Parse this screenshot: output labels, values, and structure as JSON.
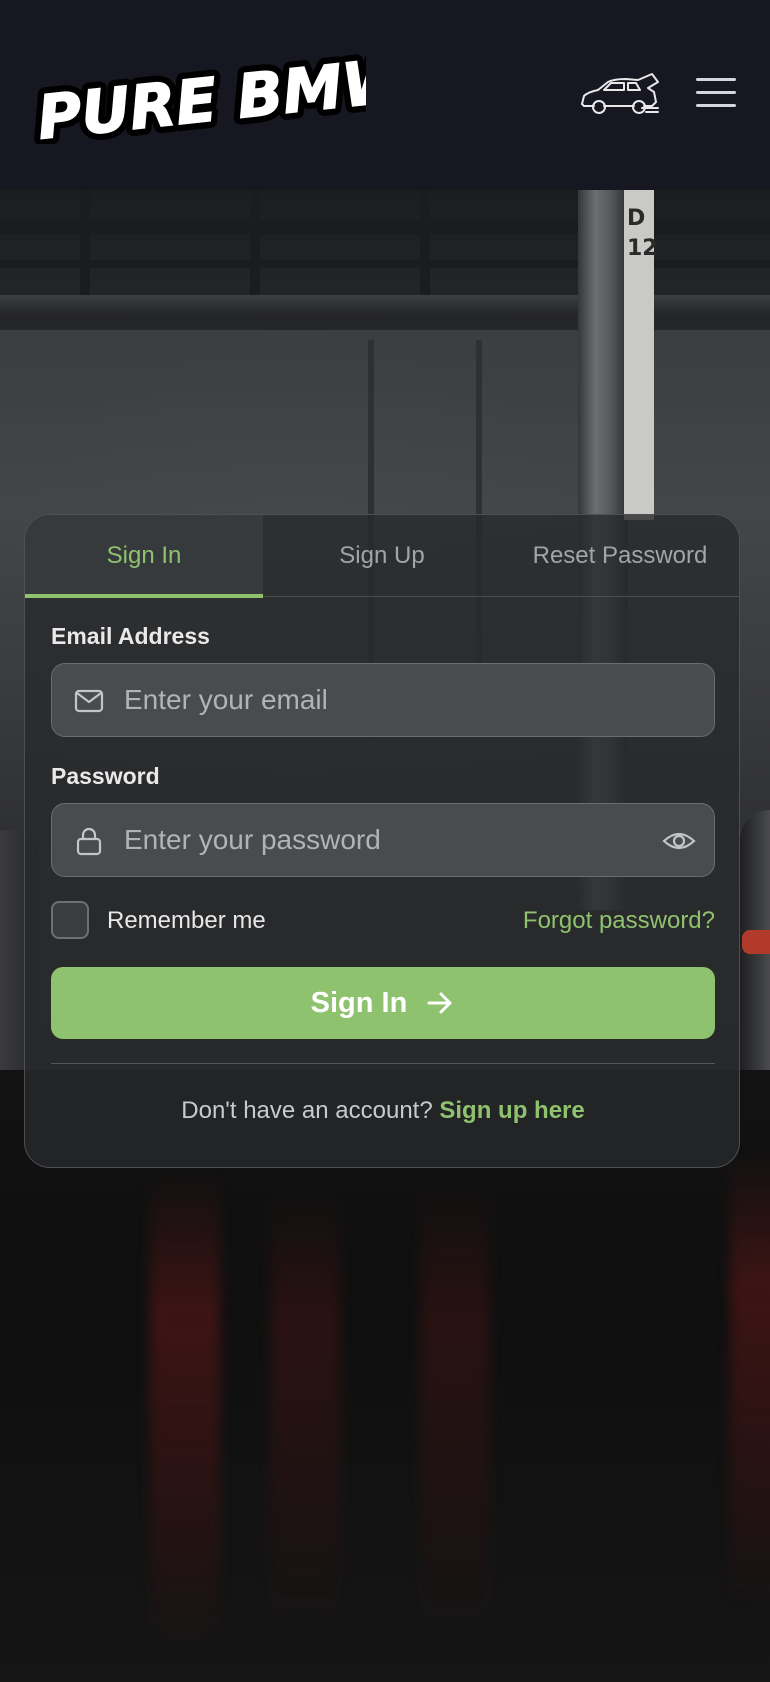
{
  "header": {
    "logo_text": "PURE BMWM",
    "car_icon": "car-hatch-open-icon",
    "menu_icon": "hamburger-menu-icon"
  },
  "background": {
    "sign_text": "D\n12"
  },
  "auth_card": {
    "tabs": [
      {
        "label": "Sign In",
        "active": true
      },
      {
        "label": "Sign Up",
        "active": false
      },
      {
        "label": "Reset Password",
        "active": false
      }
    ],
    "email": {
      "label": "Email Address",
      "placeholder": "Enter your email",
      "value": "",
      "icon": "mail-icon"
    },
    "password": {
      "label": "Password",
      "placeholder": "Enter your password",
      "value": "",
      "icon": "lock-icon",
      "toggle_icon": "eye-icon"
    },
    "remember_me": {
      "label": "Remember me",
      "checked": false
    },
    "forgot_link": "Forgot password?",
    "submit": {
      "label": "Sign In",
      "icon": "arrow-right-icon"
    },
    "footer": {
      "prompt": "Don't have an account?",
      "link": "Sign up here"
    }
  },
  "colors": {
    "accent": "#8fc26e",
    "header_bg": "#161720",
    "card_bg": "#28292b",
    "field_bg": "#4a4b4e"
  }
}
